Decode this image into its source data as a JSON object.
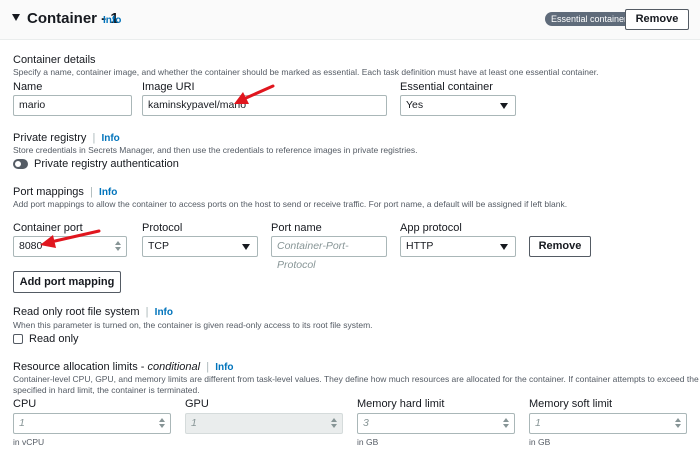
{
  "header": {
    "title": "Container - 1",
    "info": "Info",
    "badge": "Essential container",
    "remove": "Remove"
  },
  "details": {
    "heading": "Container details",
    "description": "Specify a name, container image, and whether the container should be marked as essential. Each task definition must have at least one essential container.",
    "name_label": "Name",
    "name_value": "mario",
    "image_label": "Image URI",
    "image_value": "kaminskypavel/mario",
    "essential_label": "Essential container",
    "essential_value": "Yes"
  },
  "registry": {
    "heading": "Private registry",
    "info": "Info",
    "description": "Store credentials in Secrets Manager, and then use the credentials to reference images in private registries.",
    "toggle_label": "Private registry authentication"
  },
  "ports": {
    "heading": "Port mappings",
    "info": "Info",
    "description": "Add port mappings to allow the container to access ports on the host to send or receive traffic. For port name, a default will be assigned if left blank.",
    "container_port_label": "Container port",
    "container_port_value": "8080",
    "protocol_label": "Protocol",
    "protocol_value": "TCP",
    "port_name_label": "Port name",
    "port_name_placeholder": "Container-Port-Protocol",
    "app_protocol_label": "App protocol",
    "app_protocol_value": "HTTP",
    "remove": "Remove",
    "add": "Add port mapping"
  },
  "readonly": {
    "heading": "Read only root file system",
    "info": "Info",
    "description": "When this parameter is turned on, the container is given read-only access to its root file system.",
    "checkbox_label": "Read only"
  },
  "resources": {
    "heading": "Resource allocation limits - ",
    "heading_em": "conditional",
    "info": "Info",
    "description_1": "Container-level CPU, GPU, and memory limits are different from task-level values. They define how much resources are allocated for the container. If container attempts to exceed the memory",
    "description_2": "specified in hard limit, the container is terminated.",
    "cpu_label": "CPU",
    "cpu_value": "1",
    "cpu_unit": "in vCPU",
    "gpu_label": "GPU",
    "gpu_value": "1",
    "mem_hard_label": "Memory hard limit",
    "mem_hard_value": "3",
    "mem_hard_unit": "in GB",
    "mem_soft_label": "Memory soft limit",
    "mem_soft_value": "1",
    "mem_soft_unit": "in GB"
  },
  "colors": {
    "annotation_arrow": "#e0161e",
    "link": "#0073bb"
  }
}
